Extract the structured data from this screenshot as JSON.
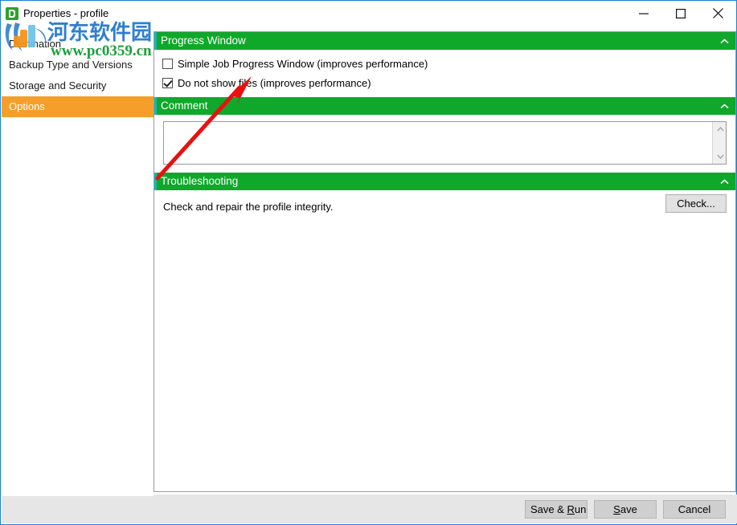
{
  "window": {
    "title": "Properties - profile",
    "app_icon": "app-icon",
    "controls": {
      "minimize": "minimize-icon",
      "maximize": "maximize-icon",
      "close": "close-icon"
    },
    "border_color": "#1982d1"
  },
  "watermark": {
    "chinese_text": "河东软件园",
    "url_text": "www.pc0359.cn",
    "chinese_color": "#2f7fd0",
    "url_color": "#1e9e3a"
  },
  "sidebar": {
    "selected_color": "#f59f2a",
    "items": [
      {
        "label": "Destination",
        "selected": false
      },
      {
        "label": "Backup Type and Versions",
        "selected": false
      },
      {
        "label": "Storage and Security",
        "selected": false
      },
      {
        "label": "Options",
        "selected": true
      }
    ]
  },
  "groups": {
    "progress": {
      "header": "Progress Window",
      "header_color": "#0fa82a",
      "accent_color": "#13b6b6",
      "collapse_icon": "chevron-up-icon",
      "checkboxes": [
        {
          "label": "Simple Job Progress Window (improves performance)",
          "checked": false
        },
        {
          "label": "Do not show files (improves performance)",
          "checked": true
        }
      ]
    },
    "comment": {
      "header": "Comment",
      "collapse_icon": "chevron-up-icon",
      "value": "",
      "placeholder": "",
      "scroll_up_icon": "scroll-up-arrow-icon",
      "scroll_down_icon": "scroll-down-arrow-icon"
    },
    "troubleshooting": {
      "header": "Troubleshooting",
      "collapse_icon": "chevron-up-icon",
      "description": "Check and repair the profile integrity.",
      "check_button": "Check..."
    }
  },
  "footer": {
    "save_run": {
      "pre": "Save & ",
      "key": "R",
      "post": "un"
    },
    "save": {
      "pre": "",
      "key": "S",
      "post": "ave"
    },
    "cancel": "Cancel"
  },
  "annotation": {
    "arrow_color": "#e8110f"
  }
}
